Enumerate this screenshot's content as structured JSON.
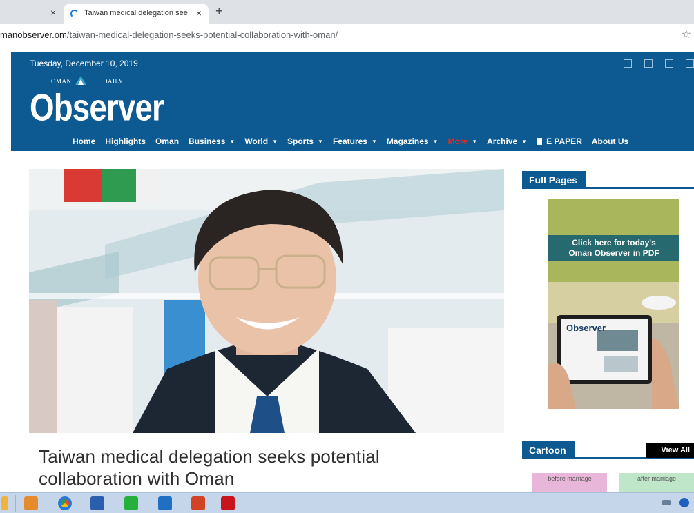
{
  "browser": {
    "prev_tab_close": "×",
    "tab_title": "Taiwan medical delegation see",
    "tab_close": "×",
    "new_tab": "+",
    "url_domain": "manobserver.om",
    "url_path": "/taiwan-medical-delegation-seeks-potential-collaboration-with-oman/",
    "star": "☆"
  },
  "header": {
    "date": "Tuesday, December 10, 2019",
    "logo_small_left": "OMAN",
    "logo_small_right": "DAILY",
    "logo_main": "Observer"
  },
  "nav": {
    "items": [
      {
        "label": "Home",
        "caret": false
      },
      {
        "label": "Highlights",
        "caret": false
      },
      {
        "label": "Oman",
        "caret": false
      },
      {
        "label": "Business",
        "caret": true
      },
      {
        "label": "World",
        "caret": true
      },
      {
        "label": "Sports",
        "caret": true
      },
      {
        "label": "Features",
        "caret": true
      },
      {
        "label": "Magazines",
        "caret": true
      },
      {
        "label": "More",
        "caret": true
      },
      {
        "label": "Archive",
        "caret": true
      },
      {
        "label": "E PAPER",
        "caret": false
      },
      {
        "label": "About Us",
        "caret": false
      }
    ]
  },
  "article": {
    "headline": "Taiwan medical delegation seeks potential collaboration with Oman"
  },
  "sidebar": {
    "full_pages_title": "Full Pages",
    "ad_text_line1": "Click here for today's",
    "ad_text_line2": "Oman Observer in PDF",
    "ad_paper_name": "Observer",
    "cartoon_title": "Cartoon",
    "view_all": "View All",
    "cartoon_left": "before marriage",
    "cartoon_right": "after marriage"
  },
  "colors": {
    "brand_blue": "#0c5a91",
    "more_red": "#d32f2f"
  }
}
